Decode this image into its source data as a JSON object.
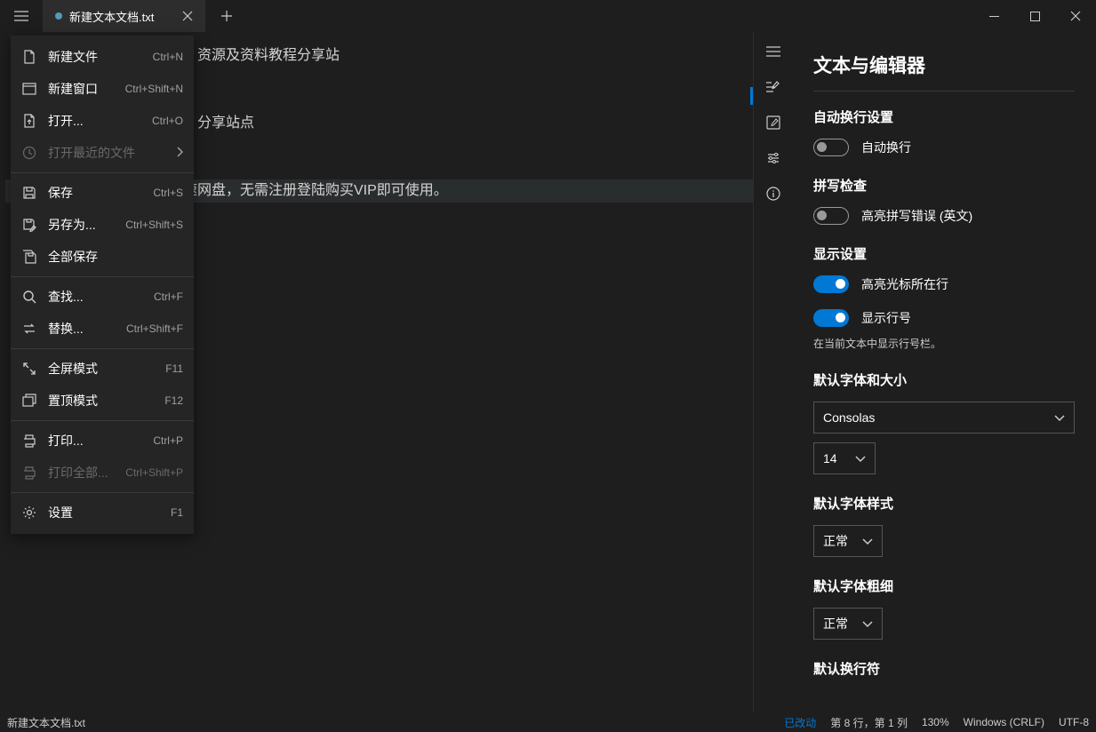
{
  "tab": {
    "title": "新建文本文档.txt"
  },
  "menu": [
    {
      "type": "item",
      "icon": "file",
      "label": "新建文件",
      "shortcut": "Ctrl+N",
      "name": "new-file"
    },
    {
      "type": "item",
      "icon": "window",
      "label": "新建窗口",
      "shortcut": "Ctrl+Shift+N",
      "name": "new-window"
    },
    {
      "type": "item",
      "icon": "open",
      "label": "打开...",
      "shortcut": "Ctrl+O",
      "name": "open"
    },
    {
      "type": "item",
      "icon": "recent",
      "label": "打开最近的文件",
      "chevron": true,
      "disabled": true,
      "name": "open-recent"
    },
    {
      "type": "sep"
    },
    {
      "type": "item",
      "icon": "save",
      "label": "保存",
      "shortcut": "Ctrl+S",
      "name": "save"
    },
    {
      "type": "item",
      "icon": "saveas",
      "label": "另存为...",
      "shortcut": "Ctrl+Shift+S",
      "name": "save-as"
    },
    {
      "type": "item",
      "icon": "saveall",
      "label": "全部保存",
      "name": "save-all"
    },
    {
      "type": "sep"
    },
    {
      "type": "item",
      "icon": "search",
      "label": "查找...",
      "shortcut": "Ctrl+F",
      "name": "find"
    },
    {
      "type": "item",
      "icon": "replace",
      "label": "替换...",
      "shortcut": "Ctrl+Shift+F",
      "name": "replace"
    },
    {
      "type": "sep"
    },
    {
      "type": "item",
      "icon": "fullscreen",
      "label": "全屏模式",
      "shortcut": "F11",
      "name": "fullscreen"
    },
    {
      "type": "item",
      "icon": "ontop",
      "label": "置顶模式",
      "shortcut": "F12",
      "name": "always-on-top"
    },
    {
      "type": "sep"
    },
    {
      "type": "item",
      "icon": "print",
      "label": "打印...",
      "shortcut": "Ctrl+P",
      "name": "print"
    },
    {
      "type": "item",
      "icon": "printall",
      "label": "打印全部...",
      "shortcut": "Ctrl+Shift+P",
      "disabled": true,
      "name": "print-all"
    },
    {
      "type": "sep"
    },
    {
      "type": "item",
      "icon": "settings",
      "label": "设置",
      "shortcut": "F1",
      "name": "settings"
    }
  ],
  "editor_lines": [
    "资源及资料教程分享站",
    "",
    "分享站点",
    "",
    "速网盘，无需注册登陆购买VIP即可使用。"
  ],
  "settings": {
    "title": "文本与编辑器",
    "wrap_section": "自动换行设置",
    "wrap_label": "自动换行",
    "spell_section": "拼写检查",
    "spell_label": "高亮拼写错误 (英文)",
    "display_section": "显示设置",
    "highlight_line": "高亮光标所在行",
    "show_lineno": "显示行号",
    "lineno_desc": "在当前文本中显示行号栏。",
    "font_section": "默认字体和大小",
    "font_name": "Consolas",
    "font_size": "14",
    "style_section": "默认字体样式",
    "style_value": "正常",
    "weight_section": "默认字体粗细",
    "weight_value": "正常",
    "lineending_section": "默认换行符"
  },
  "status": {
    "file": "新建文本文档.txt",
    "modified": "已改动",
    "position": "第 8 行，第 1 列",
    "zoom": "130%",
    "encoding_line": "Windows (CRLF)",
    "encoding": "UTF-8"
  }
}
